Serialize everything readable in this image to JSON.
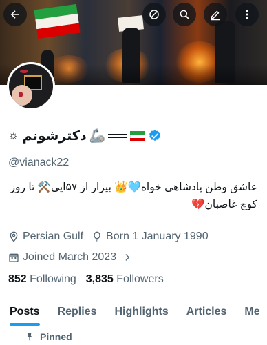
{
  "header": {
    "back_icon": "back-arrow-icon",
    "actions": [
      "no-entry-icon",
      "search-icon",
      "edit-icon",
      "more-icon"
    ]
  },
  "profile": {
    "name": "دکترشونم",
    "name_emojis": [
      "☼",
      "🦾",
      "🇮🇷"
    ],
    "verified": true,
    "handle": "@vianack22",
    "bio_line1": "عاشق وطن پادشاهی خواه🩵👑 بیزار از ۵۷ایی⚒️ تا روز",
    "bio_line2": "کوچ غاصبان💔",
    "location": "Persian Gulf",
    "birthday": "Born 1 January 1990",
    "joined": "Joined March 2023",
    "following_count": "852",
    "following_label": "Following",
    "followers_count": "3,835",
    "followers_label": "Followers"
  },
  "tabs": [
    {
      "label": "Posts",
      "active": true
    },
    {
      "label": "Replies",
      "active": false
    },
    {
      "label": "Highlights",
      "active": false
    },
    {
      "label": "Articles",
      "active": false
    },
    {
      "label": "Me",
      "active": false
    }
  ],
  "pinned_label": "Pinned",
  "colors": {
    "accent": "#1d9bf0",
    "text": "#0f1419",
    "secondary": "#536471",
    "flag_green": "#239f40",
    "flag_red": "#da0000"
  }
}
